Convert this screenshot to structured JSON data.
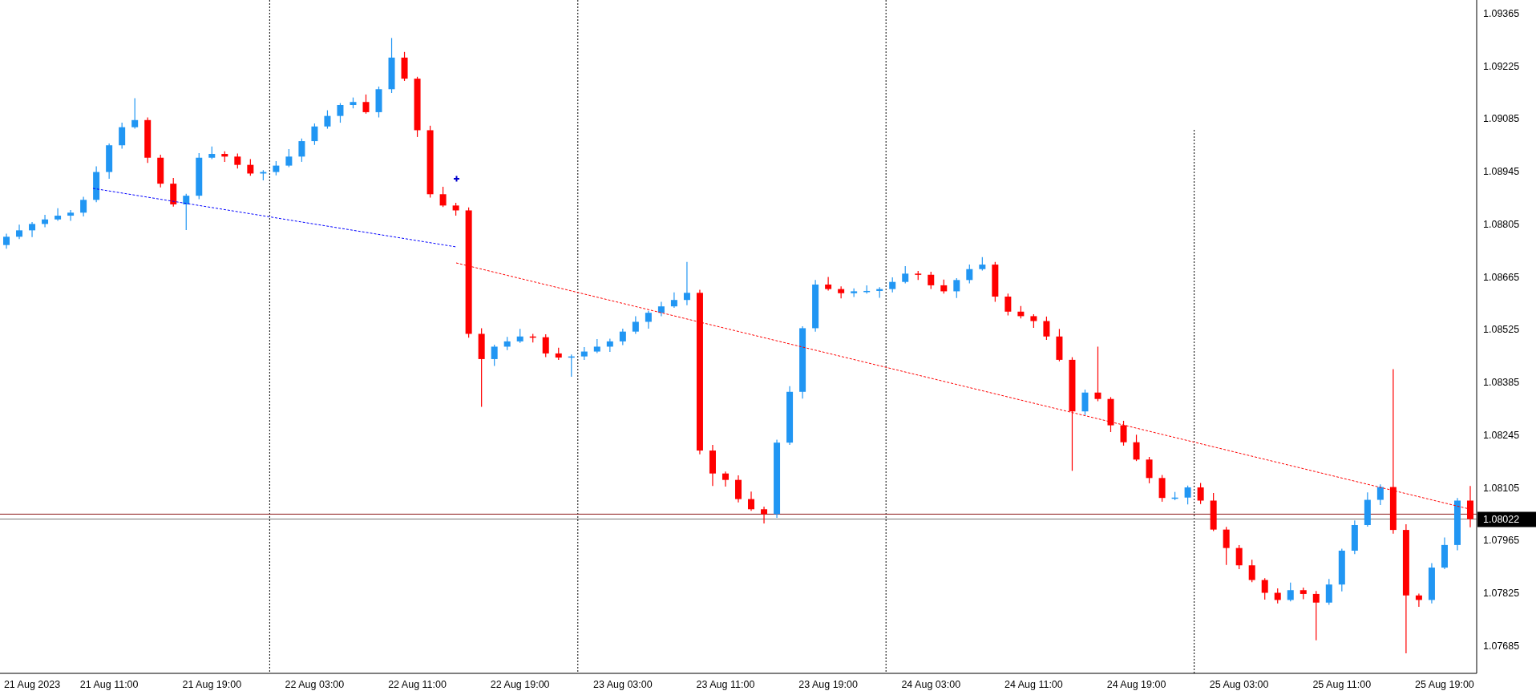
{
  "chart": {
    "chart_data": {
      "type": "candlestick",
      "categories": [
        null,
        null,
        "21 Aug 2023",
        null,
        null,
        null,
        null,
        null,
        "21 Aug 11:00",
        null,
        null,
        null,
        null,
        null,
        null,
        null,
        "21 Aug 19:00",
        null,
        null,
        null,
        null,
        null,
        null,
        null,
        "22 Aug 03:00",
        null,
        null,
        null,
        null,
        null,
        null,
        null,
        "22 Aug 11:00",
        null,
        null,
        null,
        null,
        null,
        null,
        null,
        "22 Aug 19:00",
        null,
        null,
        null,
        null,
        null,
        null,
        null,
        "23 Aug 03:00",
        null,
        null,
        null,
        null,
        null,
        null,
        null,
        "23 Aug 11:00",
        null,
        null,
        null,
        null,
        null,
        null,
        null,
        "23 Aug 19:00",
        null,
        null,
        null,
        null,
        null,
        null,
        null,
        "24 Aug 03:00",
        null,
        null,
        null,
        null,
        null,
        null,
        null,
        "24 Aug 11:00",
        null,
        null,
        null,
        null,
        null,
        null,
        null,
        "24 Aug 19:00",
        null,
        null,
        null,
        null,
        null,
        null,
        null,
        "25 Aug 03:00",
        null,
        null,
        null,
        null,
        null,
        null,
        null,
        "25 Aug 11:00",
        null,
        null,
        null,
        null,
        null,
        null,
        null,
        "25 Aug 19:00",
        null,
        null
      ],
      "ref_lines": [
        {
          "axis": "y",
          "value": 1.08035,
          "color": "#8b1a1a"
        },
        {
          "axis": "y",
          "value": 1.08022,
          "color": "#777777"
        }
      ],
      "ohlc": [
        [
          1.0875,
          1.0878,
          1.0874,
          1.08772
        ],
        [
          1.08772,
          1.08804,
          1.08766,
          1.08789
        ],
        [
          1.08789,
          1.08811,
          1.08771,
          1.08806
        ],
        [
          1.08806,
          1.0883,
          1.08797,
          1.08818
        ],
        [
          1.08818,
          1.08848,
          1.08814,
          1.08828
        ],
        [
          1.08828,
          1.08843,
          1.08814,
          1.08836
        ],
        [
          1.08836,
          1.08878,
          1.08826,
          1.0887
        ],
        [
          1.0887,
          1.08959,
          1.08864,
          1.08944
        ],
        [
          1.08944,
          1.0902,
          1.08926,
          1.09015
        ],
        [
          1.09015,
          1.09075,
          1.09006,
          1.09063
        ],
        [
          1.09063,
          1.0914,
          1.09059,
          1.09082
        ],
        [
          1.09082,
          1.09089,
          1.08968,
          1.08982
        ],
        [
          1.08982,
          1.0899,
          1.08903,
          1.08913
        ],
        [
          1.08913,
          1.08928,
          1.08852,
          1.08858
        ],
        [
          1.08858,
          1.08886,
          1.0879,
          1.08881
        ],
        [
          1.08881,
          1.08994,
          1.08872,
          1.08982
        ],
        [
          1.08982,
          1.09012,
          1.08978,
          1.08992
        ],
        [
          1.08992,
          1.08999,
          1.08971,
          1.08985
        ],
        [
          1.08985,
          1.08993,
          1.08953,
          1.08963
        ],
        [
          1.08963,
          1.08978,
          1.08934,
          1.0894
        ],
        [
          1.0894,
          1.08949,
          1.08922,
          1.08944
        ],
        [
          1.08944,
          1.08973,
          1.08935,
          1.08961
        ],
        [
          1.08961,
          1.09005,
          1.08957,
          1.08985
        ],
        [
          1.08985,
          1.09033,
          1.08971,
          1.09026
        ],
        [
          1.09026,
          1.09073,
          1.09016,
          1.09065
        ],
        [
          1.09065,
          1.09108,
          1.09059,
          1.09093
        ],
        [
          1.09093,
          1.09127,
          1.09075,
          1.09122
        ],
        [
          1.09122,
          1.09142,
          1.09113,
          1.0913
        ],
        [
          1.0913,
          1.0915,
          1.09099,
          1.09103
        ],
        [
          1.09103,
          1.09171,
          1.09089,
          1.09164
        ],
        [
          1.09164,
          1.093,
          1.09154,
          1.09248
        ],
        [
          1.09248,
          1.09263,
          1.09186,
          1.09192
        ],
        [
          1.09192,
          1.09197,
          1.09037,
          1.09055
        ],
        [
          1.09055,
          1.09067,
          1.08876,
          1.08885
        ],
        [
          1.08885,
          1.08905,
          1.08851,
          1.08855
        ],
        [
          1.08855,
          1.08862,
          1.08828,
          1.08842
        ],
        [
          1.08842,
          1.0885,
          1.08504,
          1.08514
        ],
        [
          1.08514,
          1.08529,
          1.0832,
          1.08447
        ],
        [
          1.08447,
          1.08485,
          1.08429,
          1.0848
        ],
        [
          1.0848,
          1.08506,
          1.08471,
          1.08494
        ],
        [
          1.08494,
          1.08527,
          1.0849,
          1.08507
        ],
        [
          1.08507,
          1.08514,
          1.08491,
          1.08505
        ],
        [
          1.08505,
          1.08513,
          1.08452,
          1.08462
        ],
        [
          1.08462,
          1.08477,
          1.08445,
          1.08451
        ],
        [
          1.08451,
          1.08459,
          1.084,
          1.08454
        ],
        [
          1.08454,
          1.08479,
          1.08445,
          1.08467
        ],
        [
          1.08467,
          1.085,
          1.08463,
          1.0848
        ],
        [
          1.0848,
          1.08501,
          1.08466,
          1.08494
        ],
        [
          1.08494,
          1.08528,
          1.08484,
          1.0852
        ],
        [
          1.0852,
          1.08561,
          1.08514,
          1.08546
        ],
        [
          1.08546,
          1.08575,
          1.08528,
          1.0857
        ],
        [
          1.0857,
          1.08599,
          1.08561,
          1.08587
        ],
        [
          1.08587,
          1.08624,
          1.08583,
          1.08604
        ],
        [
          1.08604,
          1.08705,
          1.0859,
          1.08623
        ],
        [
          1.08623,
          1.08631,
          1.08194,
          1.08204
        ],
        [
          1.08204,
          1.08219,
          1.0811,
          1.08143
        ],
        [
          1.08143,
          1.08148,
          1.08108,
          1.08126
        ],
        [
          1.08126,
          1.08138,
          1.08066,
          1.08075
        ],
        [
          1.08075,
          1.08095,
          1.08044,
          1.08048
        ],
        [
          1.08048,
          1.08055,
          1.0801,
          1.08035
        ],
        [
          1.08035,
          1.08233,
          1.08025,
          1.08225
        ],
        [
          1.08225,
          1.08375,
          1.08219,
          1.0836
        ],
        [
          1.0836,
          1.08534,
          1.08342,
          1.08529
        ],
        [
          1.08529,
          1.08657,
          1.0852,
          1.08645
        ],
        [
          1.08645,
          1.08665,
          1.08629,
          1.08633
        ],
        [
          1.08633,
          1.0864,
          1.08608,
          1.08622
        ],
        [
          1.08622,
          1.08635,
          1.08612,
          1.08627
        ],
        [
          1.08627,
          1.08643,
          1.08621,
          1.08628
        ],
        [
          1.08628,
          1.08638,
          1.0861,
          1.08633
        ],
        [
          1.08633,
          1.08664,
          1.08624,
          1.08652
        ],
        [
          1.08652,
          1.08694,
          1.08648,
          1.08674
        ],
        [
          1.08674,
          1.08681,
          1.08657,
          1.08671
        ],
        [
          1.08671,
          1.08679,
          1.08633,
          1.08643
        ],
        [
          1.08643,
          1.08658,
          1.08621,
          1.08627
        ],
        [
          1.08627,
          1.08662,
          1.08609,
          1.08657
        ],
        [
          1.08657,
          1.08698,
          1.08648,
          1.08686
        ],
        [
          1.08686,
          1.08718,
          1.08682,
          1.08698
        ],
        [
          1.08698,
          1.08705,
          1.08599,
          1.08613
        ],
        [
          1.08613,
          1.08621,
          1.08563,
          1.08573
        ],
        [
          1.08573,
          1.08588,
          1.08555,
          1.08561
        ],
        [
          1.08561,
          1.08566,
          1.0853,
          1.08548
        ],
        [
          1.08548,
          1.0856,
          1.08498,
          1.08507
        ],
        [
          1.08507,
          1.08527,
          1.08441,
          1.08445
        ],
        [
          1.08445,
          1.08452,
          1.0815,
          1.08308
        ],
        [
          1.08308,
          1.08366,
          1.08298,
          1.08358
        ],
        [
          1.08358,
          1.0848,
          1.08335,
          1.08341
        ],
        [
          1.08341,
          1.08346,
          1.08253,
          1.08271
        ],
        [
          1.08271,
          1.08283,
          1.08217,
          1.08226
        ],
        [
          1.08226,
          1.08246,
          1.08176,
          1.0818
        ],
        [
          1.0818,
          1.08187,
          1.08117,
          1.08131
        ],
        [
          1.08131,
          1.08139,
          1.08068,
          1.08078
        ],
        [
          1.08078,
          1.08094,
          1.08072,
          1.08079
        ],
        [
          1.08079,
          1.08111,
          1.08061,
          1.08106
        ],
        [
          1.08106,
          1.08118,
          1.08062,
          1.08071
        ],
        [
          1.08071,
          1.08091,
          1.0799,
          1.07994
        ],
        [
          1.07994,
          1.08001,
          1.079,
          1.07945
        ],
        [
          1.07945,
          1.07953,
          1.07889,
          1.07899
        ],
        [
          1.07899,
          1.07914,
          1.07854,
          1.0786
        ],
        [
          1.0786,
          1.07865,
          1.07808,
          1.07826
        ],
        [
          1.07826,
          1.07838,
          1.07798,
          1.07807
        ],
        [
          1.07807,
          1.07853,
          1.07803,
          1.07833
        ],
        [
          1.07833,
          1.0784,
          1.07809,
          1.07823
        ],
        [
          1.07823,
          1.07831,
          1.077,
          1.078
        ],
        [
          1.078,
          1.07863,
          1.07794,
          1.07848
        ],
        [
          1.07848,
          1.07943,
          1.0783,
          1.07938
        ],
        [
          1.07938,
          1.08018,
          1.07929,
          1.08006
        ],
        [
          1.08006,
          1.08093,
          1.08002,
          1.08073
        ],
        [
          1.08073,
          1.08114,
          1.08059,
          1.08107
        ],
        [
          1.08107,
          1.0842,
          1.07983,
          1.07993
        ],
        [
          1.07993,
          1.08008,
          1.07665,
          1.07819
        ],
        [
          1.07819,
          1.07824,
          1.07789,
          1.07807
        ],
        [
          1.07807,
          1.07905,
          1.07798,
          1.07893
        ],
        [
          1.07893,
          1.07973,
          1.07889,
          1.07953
        ],
        [
          1.07953,
          1.08078,
          1.07939,
          1.08071
        ],
        [
          1.08071,
          1.0811,
          1.08,
          1.08022
        ]
      ],
      "ylim": [
        1.07612,
        1.09401
      ],
      "yticks": [
        {
          "value": 1.09365,
          "label": "1.09365"
        },
        {
          "value": 1.09225,
          "label": "1.09225"
        },
        {
          "value": 1.09085,
          "label": "1.09085"
        },
        {
          "value": 1.08945,
          "label": "1.08945"
        },
        {
          "value": 1.08805,
          "label": "1.08805"
        },
        {
          "value": 1.08665,
          "label": "1.08665"
        },
        {
          "value": 1.08525,
          "label": "1.08525"
        },
        {
          "value": 1.08385,
          "label": "1.08385"
        },
        {
          "value": 1.08245,
          "label": "1.08245"
        },
        {
          "value": 1.08105,
          "label": "1.08105"
        },
        {
          "value": 1.07965,
          "label": "1.07965"
        },
        {
          "value": 1.07825,
          "label": "1.07825"
        },
        {
          "value": 1.07685,
          "label": "1.07685"
        }
      ]
    },
    "current_price": "1.08022"
  }
}
